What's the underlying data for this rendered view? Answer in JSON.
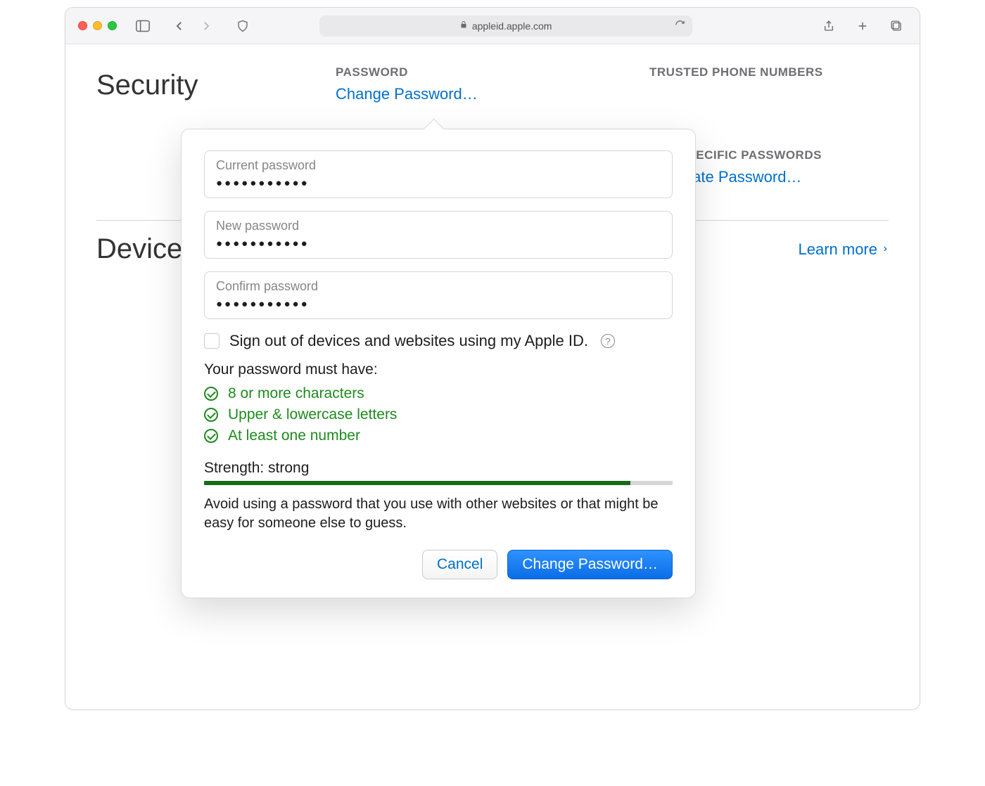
{
  "browser": {
    "url": "appleid.apple.com"
  },
  "page": {
    "security_title": "Security",
    "password_heading": "PASSWORD",
    "change_password_link": "Change Password…",
    "trusted_heading": "TRUSTED PHONE NUMBERS",
    "app_specific_heading": "APP-SPECIFIC PASSWORDS",
    "generate_link": "Generate Password…",
    "devices_title": "Devices",
    "learn_more": "Learn more"
  },
  "popover": {
    "fields": {
      "current_label": "Current password",
      "current_value": "●●●●●●●●●●●",
      "new_label": "New password",
      "new_value": "●●●●●●●●●●●",
      "confirm_label": "Confirm password",
      "confirm_value": "●●●●●●●●●●●"
    },
    "signout_label": "Sign out of devices and websites using my Apple ID.",
    "must_have_title": "Your password must have:",
    "req1": "8 or more characters",
    "req2": "Upper & lowercase letters",
    "req3": "At least one number",
    "strength_label": "Strength: strong",
    "advice": "Avoid using a password that you use with other websites or that might be easy for someone else to guess.",
    "cancel": "Cancel",
    "submit": "Change Password…"
  }
}
